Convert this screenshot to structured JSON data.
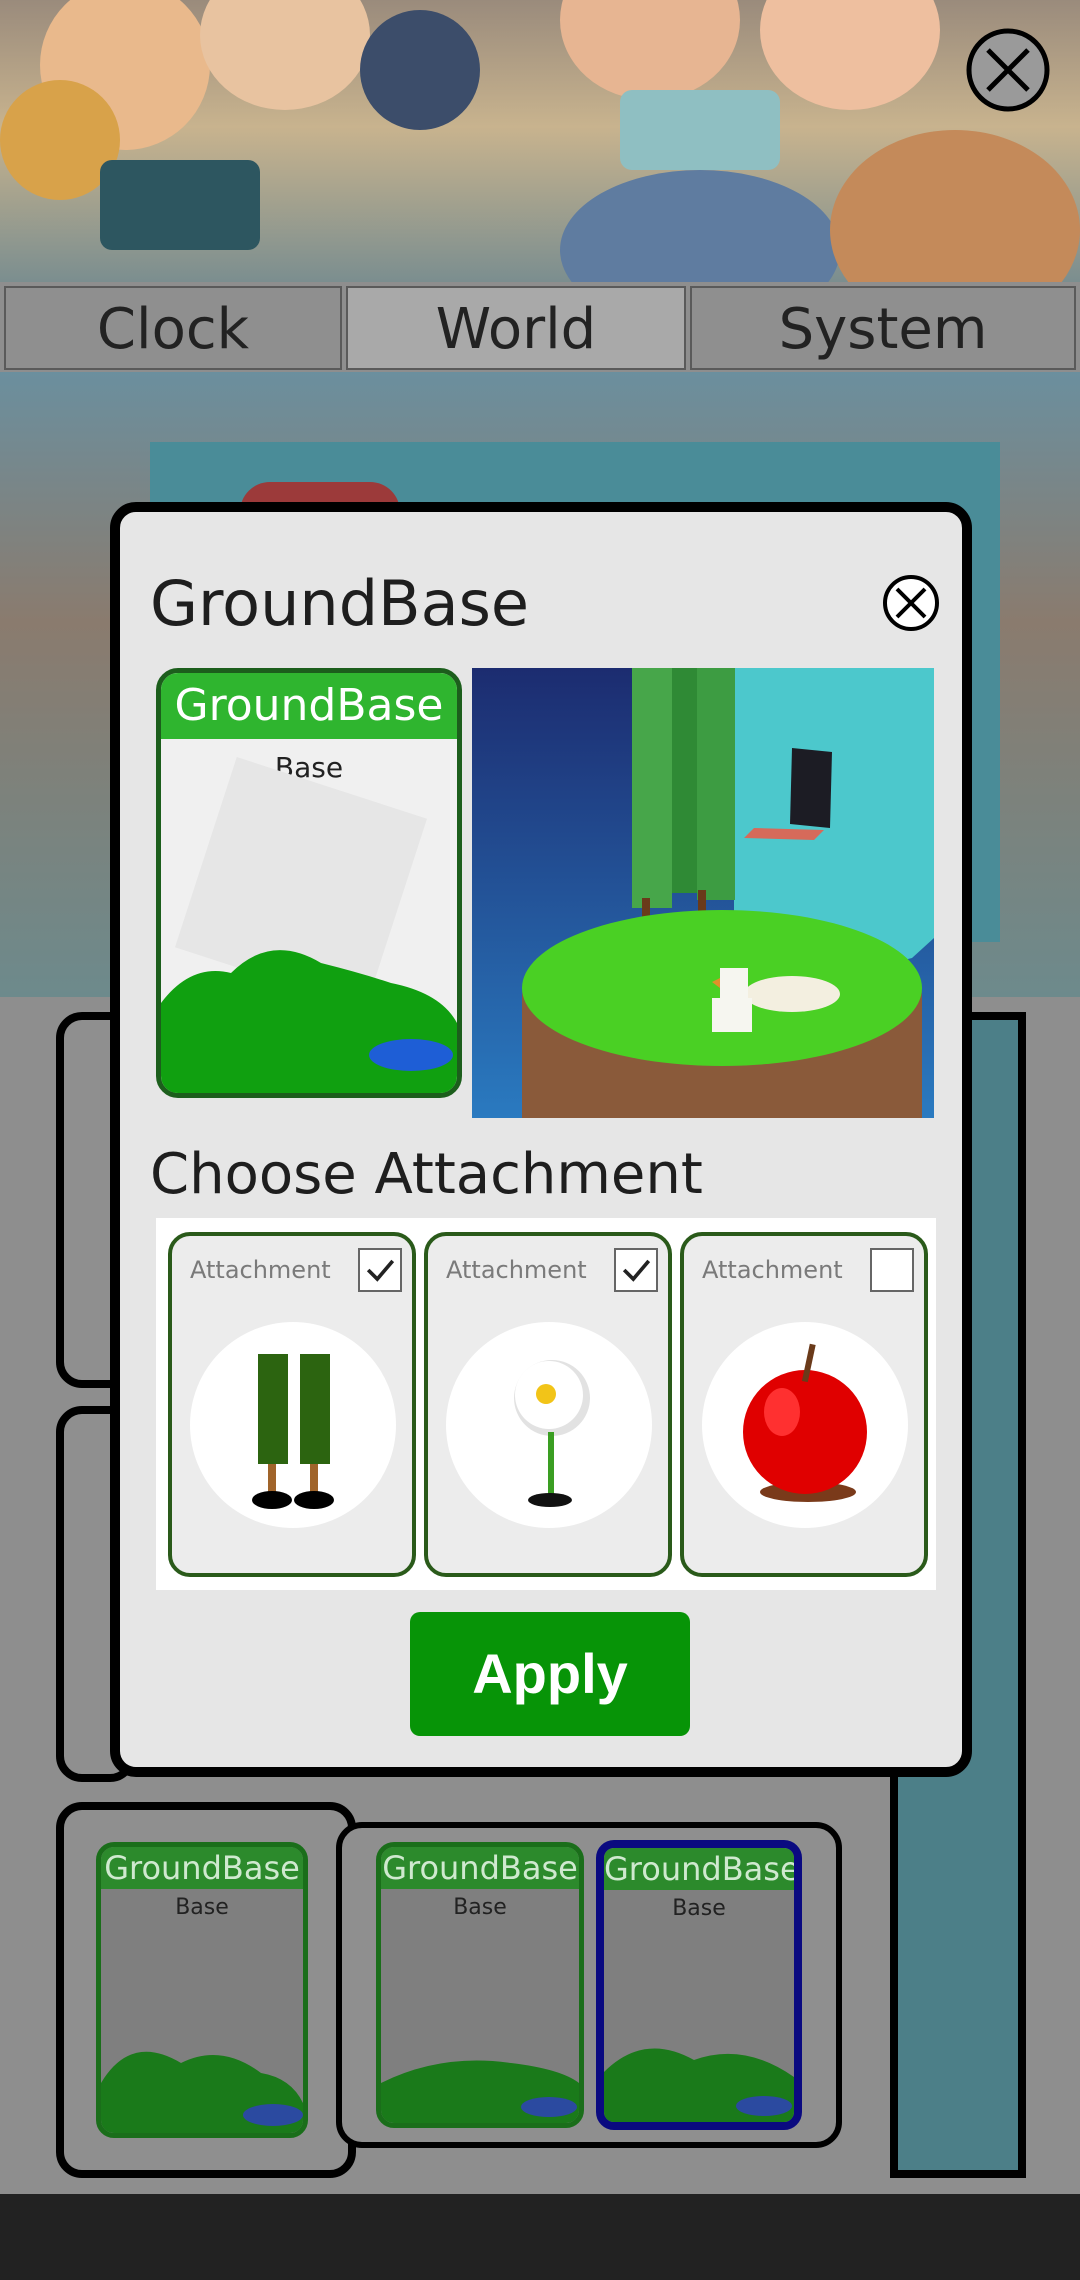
{
  "top_bar": {
    "close_icon": "close-circle-icon"
  },
  "tabs": [
    {
      "label": "Clock",
      "active": false
    },
    {
      "label": "World",
      "active": true
    },
    {
      "label": "System",
      "active": false
    }
  ],
  "background_cards": [
    {
      "title": "GroundBase",
      "subtitle": "Base"
    },
    {
      "title": "GroundBase",
      "subtitle": "Base"
    },
    {
      "title": "GroundBase",
      "subtitle": "Base",
      "selected": true
    }
  ],
  "modal": {
    "title": "GroundBase",
    "close_icon": "close-circle-icon",
    "card": {
      "title": "GroundBase",
      "subtitle": "Base"
    },
    "attach_heading": "Choose Attachment",
    "attachments": [
      {
        "label": "Attachment",
        "checked": true,
        "icon": "tree-trunks-icon"
      },
      {
        "label": "Attachment",
        "checked": true,
        "icon": "daisy-flower-icon"
      },
      {
        "label": "Attachment",
        "checked": false,
        "icon": "apple-icon"
      }
    ],
    "apply_label": "Apply"
  },
  "colors": {
    "card_header": "#2fb52f",
    "card_border": "#1c5e1c",
    "apply_button": "#079407",
    "selected_border": "#0a0a80"
  }
}
